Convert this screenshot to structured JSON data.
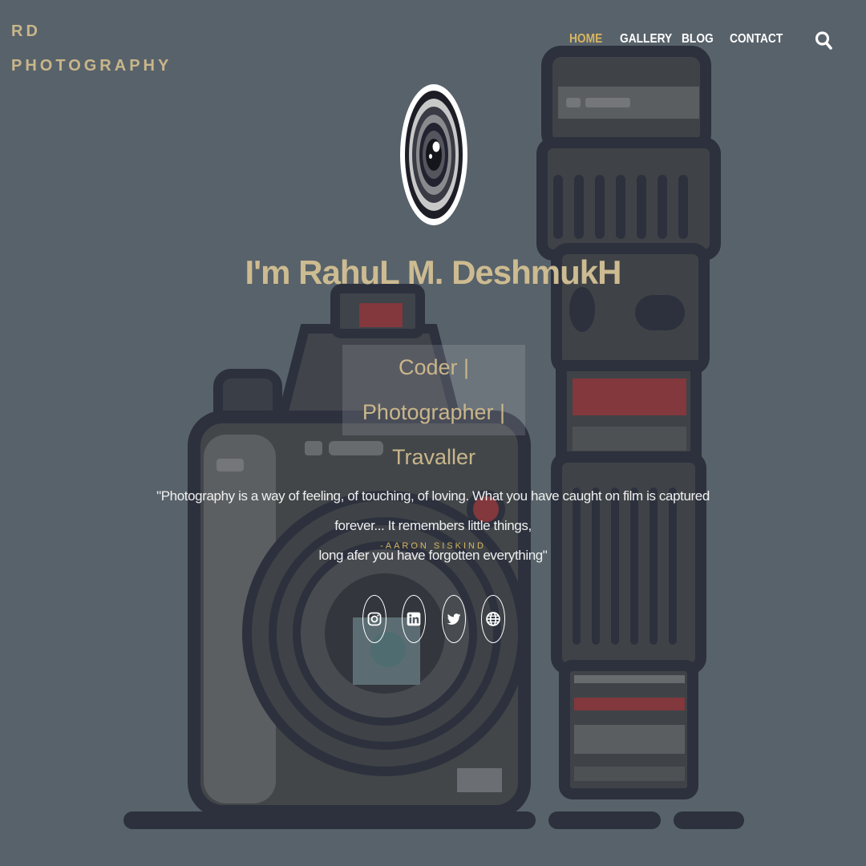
{
  "brand": {
    "line1": "RD",
    "line2": "PHOTOGRAPHY"
  },
  "nav": {
    "home": "HOME",
    "gallery": "GALLERY",
    "blog": "BLOG",
    "contact": "CONTACT"
  },
  "hero": {
    "title": "I'm RahuL M. DeshmukH",
    "tagline_line1": "Coder | Photographer |",
    "tagline_line2": "Travaller",
    "quote_line1": "\"Photography is a way of feeling, of touching, of loving. What you have caught on film is captured forever... It remembers little things,",
    "quote_line2": "long afer you have forgotten everything\"",
    "author": "-AARON SISKIND"
  },
  "icons": {
    "search": "search-icon",
    "avatar": "camera-lens-icon",
    "socials": [
      "instagram-icon",
      "linkedin-icon",
      "twitter-icon",
      "globe-icon"
    ]
  },
  "colors": {
    "accent": "#d7b560",
    "title": "#cdbb91",
    "background": "#58626b"
  }
}
